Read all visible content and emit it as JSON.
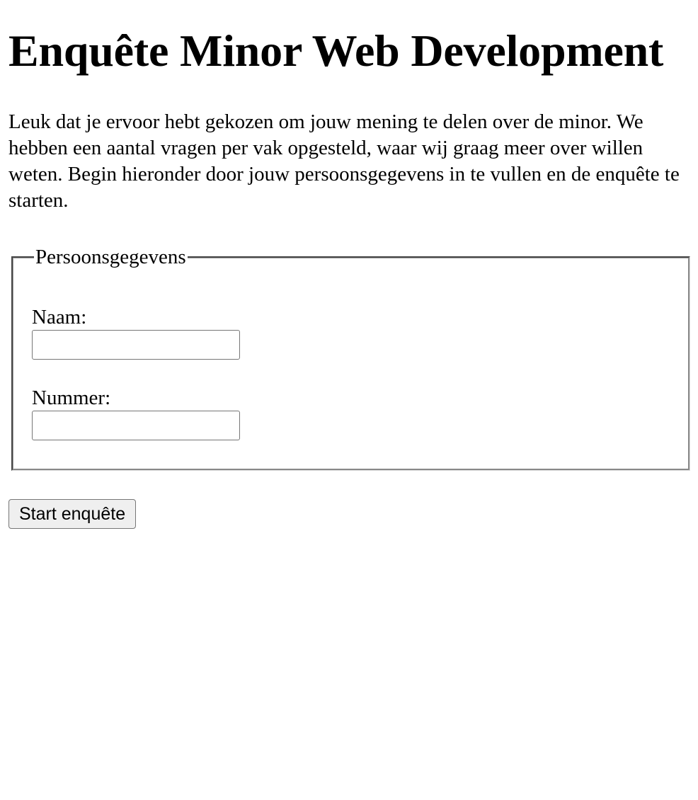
{
  "page": {
    "title": "Enquête Minor Web Development",
    "intro": "Leuk dat je ervoor hebt gekozen om jouw mening te delen over de minor. We hebben een aantal vragen per vak opgesteld, waar wij graag meer over willen weten. Begin hieronder door jouw persoonsgegevens in te vullen en de enquête te starten."
  },
  "form": {
    "legend": "Persoonsgegevens",
    "fields": [
      {
        "label": "Naam:",
        "value": "",
        "placeholder": ""
      },
      {
        "label": "Nummer:",
        "value": "",
        "placeholder": ""
      }
    ],
    "submit_label": "Start enquête"
  },
  "colors": {
    "text": "#000000",
    "background": "#ffffff",
    "button_background": "#efefef",
    "input_border": "#767676",
    "fieldset_border": "#8a8a8a"
  }
}
